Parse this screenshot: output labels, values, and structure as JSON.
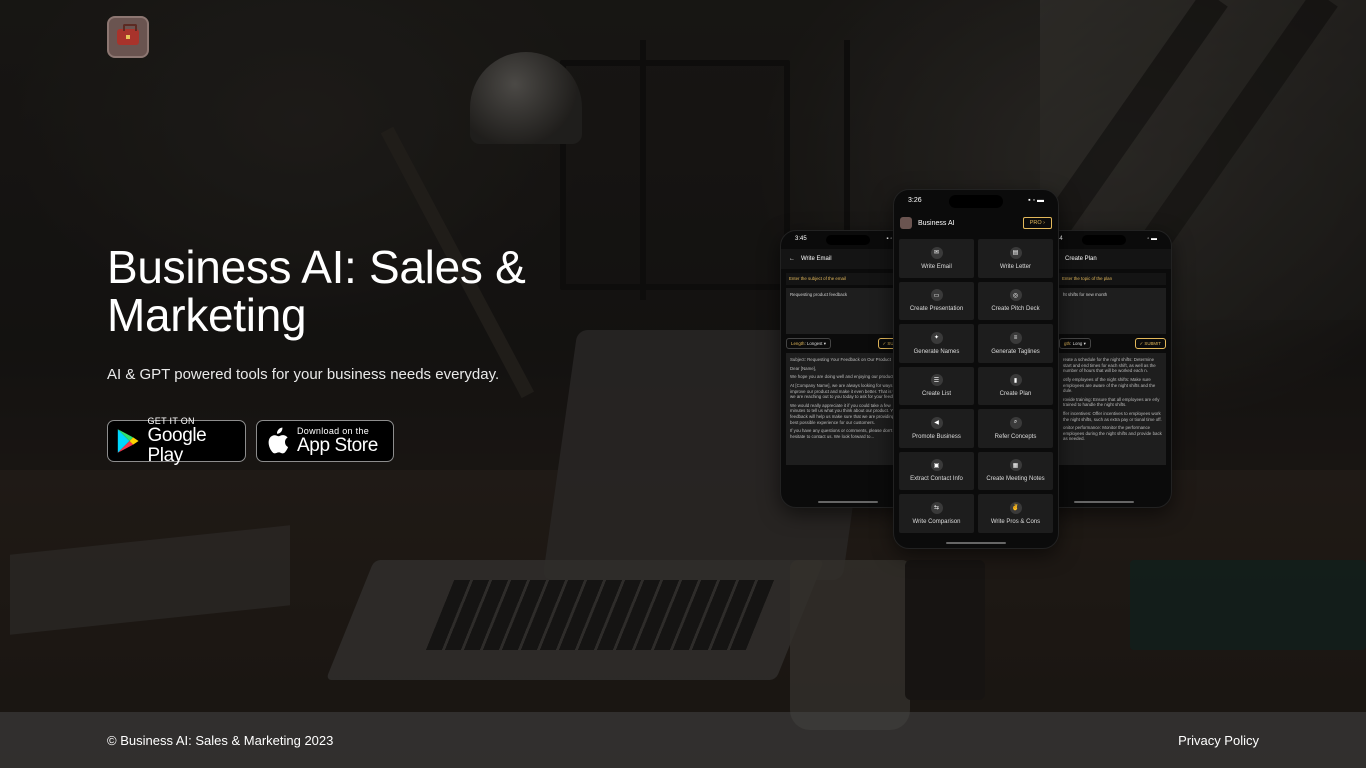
{
  "hero": {
    "title": "Business AI: Sales & Marketing",
    "subtitle": "AI & GPT powered tools for your business needs everyday."
  },
  "store_buttons": {
    "google_play": {
      "small": "GET IT ON",
      "big": "Google Play"
    },
    "app_store": {
      "small": "Download on the",
      "big": "App Store"
    }
  },
  "phones": {
    "left": {
      "time": "3:45",
      "title": "Write Email",
      "input_label": "Enter the subject of the email",
      "input_value": "Requesting product feedback",
      "length_label": "Length",
      "length_value": "Longest",
      "submit": "SUBMIT",
      "output": [
        "Subject: Requesting Your Feedback on Our Product",
        "Dear [Name],",
        "We hope you are doing well and enjoying our product.",
        "At [Company Name], we are always looking for ways to improve our product and make it even better. That is why we are reaching out to you today to ask for your feedback.",
        "We would really appreciate it if you could take a few minutes to tell us what you think about our product. Your feedback will help us make sure that we are providing the best possible experience for our customers.",
        "If you have any questions or comments, please don't hesitate to contact us. We look forward to..."
      ]
    },
    "center": {
      "time": "3:26",
      "app_name": "Business AI",
      "pro_label": "PRO",
      "tiles": [
        {
          "label": "Write Email",
          "icon": "email-icon"
        },
        {
          "label": "Write Letter",
          "icon": "letter-icon"
        },
        {
          "label": "Create Presentation",
          "icon": "presentation-icon"
        },
        {
          "label": "Create Pitch Deck",
          "icon": "pitch-deck-icon"
        },
        {
          "label": "Generate Names",
          "icon": "magic-wand-icon"
        },
        {
          "label": "Generate Taglines",
          "icon": "tagline-icon"
        },
        {
          "label": "Create List",
          "icon": "list-icon"
        },
        {
          "label": "Create Plan",
          "icon": "chart-icon"
        },
        {
          "label": "Promote Business",
          "icon": "megaphone-icon"
        },
        {
          "label": "Refer Concepts",
          "icon": "search-doc-icon"
        },
        {
          "label": "Extract Contact Info",
          "icon": "contact-card-icon"
        },
        {
          "label": "Create Meeting Notes",
          "icon": "notes-icon"
        },
        {
          "label": "Write Comparison",
          "icon": "compare-icon"
        },
        {
          "label": "Write Pros & Cons",
          "icon": "thumbs-icon"
        }
      ]
    },
    "right": {
      "time": "3:54",
      "title": "Create Plan",
      "input_label": "Enter the topic of the plan",
      "input_value": "ht shifts for new month",
      "length_label": "gth",
      "length_value": "Long",
      "submit": "SUBMIT",
      "output": [
        "reate a schedule for the night shifts: Determine start and end times for each shift, as well as the number of hours that will be worked each n.",
        "otify employees of the night shifts: Make sure employees are aware of the night shifts and the dule.",
        "rovide training: Ensure that all employees are erly trained to handle the night shifts.",
        "ffer incentives: Offer incentives to employees work the night shifts, such as extra pay or tional time off.",
        "onitor performance: Monitor the performance employees during the night shifts and provide back as needed."
      ]
    }
  },
  "footer": {
    "copyright": "© Business AI: Sales & Marketing 2023",
    "privacy": "Privacy Policy"
  },
  "colors": {
    "accent": "#e3b85a",
    "logo_bg": "#6a5450"
  }
}
